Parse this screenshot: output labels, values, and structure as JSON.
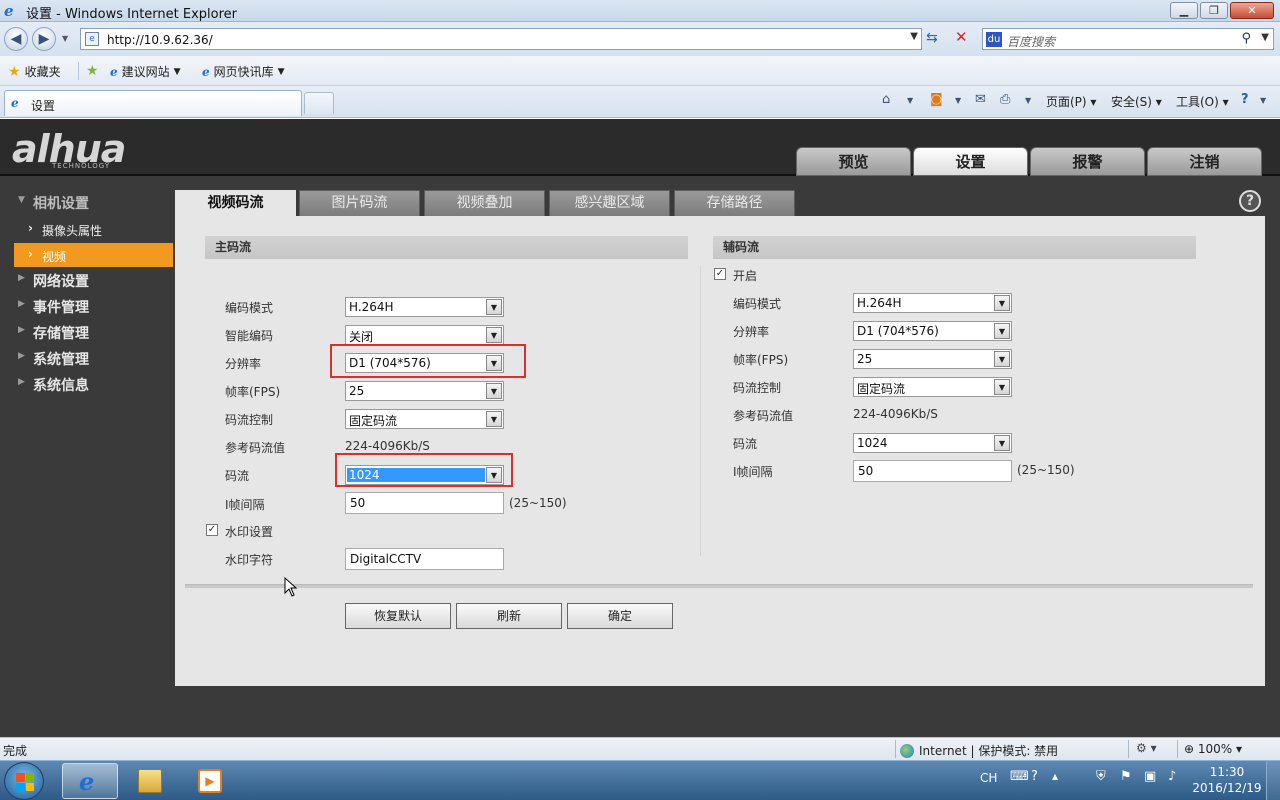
{
  "window": {
    "title": "设置 - Windows Internet Explorer",
    "min": "▁",
    "restore": "❐",
    "close": "✕"
  },
  "address": {
    "url": "http://10.9.62.36/",
    "search_placeholder": "百度搜索"
  },
  "favorites": {
    "favorites_label": "收藏夹",
    "suggested_sites": "建议网站",
    "web_slice": "网页快讯库"
  },
  "ie_tab": {
    "label": "设置"
  },
  "commands": {
    "page": "页面(P)",
    "safety": "安全(S)",
    "tools": "工具(O)"
  },
  "app": {
    "logo": "alhua",
    "logo_sub": "TECHNOLOGY",
    "top_tabs": [
      "预览",
      "设置",
      "报警",
      "注销"
    ],
    "sidebar": {
      "camera_settings": "相机设置",
      "camera_props": "摄像头属性",
      "video": "视频",
      "network": "网络设置",
      "events": "事件管理",
      "storage": "存储管理",
      "system": "系统管理",
      "info": "系统信息"
    },
    "content_tabs": [
      "视频码流",
      "图片码流",
      "视频叠加",
      "感兴趣区域",
      "存储路径"
    ],
    "main_stream": {
      "heading": "主码流",
      "encode_mode_label": "编码模式",
      "encode_mode": "H.264H",
      "smart_codec_label": "智能编码",
      "smart_codec": "关闭",
      "resolution_label": "分辨率",
      "resolution": "D1 (704*576)",
      "fps_label": "帧率(FPS)",
      "fps": "25",
      "bitrate_ctrl_label": "码流控制",
      "bitrate_ctrl": "固定码流",
      "ref_bitrate_label": "参考码流值",
      "ref_bitrate": "224-4096Kb/S",
      "bitrate_label": "码流",
      "bitrate": "1024",
      "iframe_label": "I帧间隔",
      "iframe": "50",
      "iframe_hint": "(25~150)",
      "watermark_label": "水印设置",
      "watermark_text_label": "水印字符",
      "watermark_text": "DigitalCCTV"
    },
    "sub_stream": {
      "heading": "辅码流",
      "enable_label": "开启",
      "encode_mode_label": "编码模式",
      "encode_mode": "H.264H",
      "resolution_label": "分辨率",
      "resolution": "D1 (704*576)",
      "fps_label": "帧率(FPS)",
      "fps": "25",
      "bitrate_ctrl_label": "码流控制",
      "bitrate_ctrl": "固定码流",
      "ref_bitrate_label": "参考码流值",
      "ref_bitrate": "224-4096Kb/S",
      "bitrate_label": "码流",
      "bitrate": "1024",
      "iframe_label": "I帧间隔",
      "iframe": "50",
      "iframe_hint": "(25~150)"
    },
    "buttons": {
      "restore_default": "恢复默认",
      "refresh": "刷新",
      "ok": "确定"
    }
  },
  "status": {
    "left": "完成",
    "zone": "Internet | 保护模式: 禁用",
    "zoom": "100%"
  },
  "taskbar": {
    "lang": "CH",
    "time": "11:30",
    "date": "2016/12/19"
  },
  "colors": {
    "accent_orange": "#f29a1f",
    "highlight_red": "#d9302c",
    "selection_blue": "#3399ff"
  }
}
